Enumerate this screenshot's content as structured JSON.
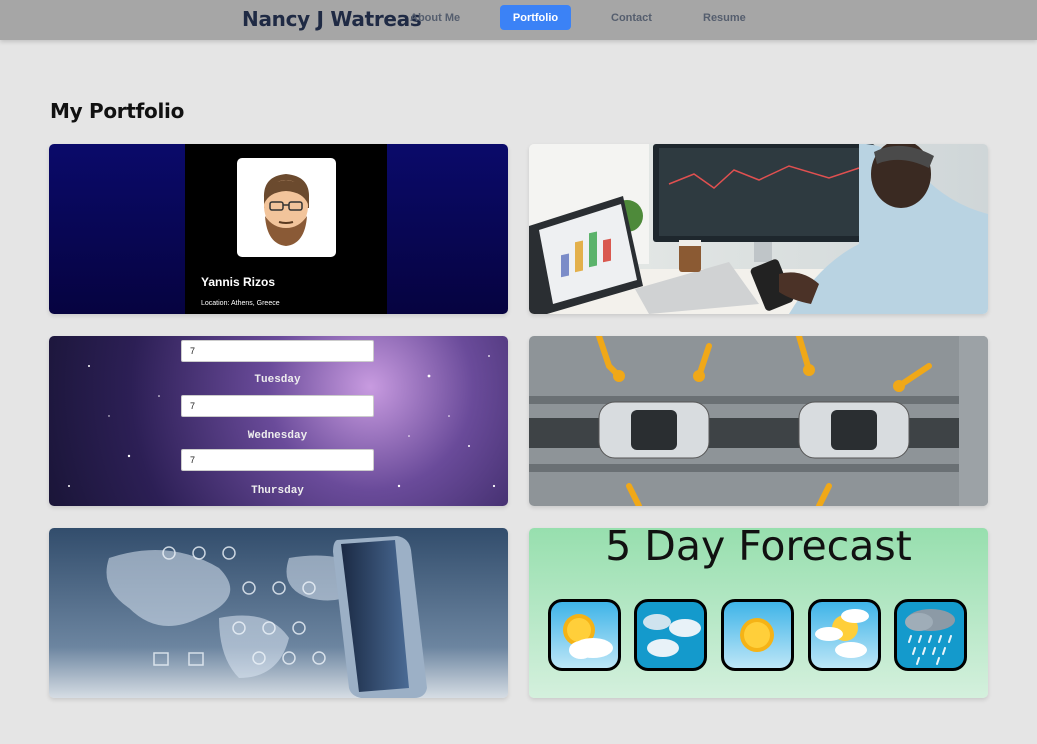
{
  "nav": {
    "brand": "Nancy J Watreas",
    "links": [
      {
        "label": "About Me"
      },
      {
        "label": "Portfolio",
        "active": true
      },
      {
        "label": "Contact"
      },
      {
        "label": "Resume"
      }
    ],
    "active_color": "#3b82f6"
  },
  "main": {
    "title": "My Portfolio"
  },
  "cards": {
    "profile": {
      "name": "Yannis Rizos",
      "location": "Location: Athens, Greece"
    },
    "planner": {
      "rows": [
        {
          "value": "7",
          "day": "Tuesday"
        },
        {
          "value": "7",
          "day": "Wednesday"
        },
        {
          "value": "7",
          "day": "Thursday"
        }
      ]
    },
    "weather": {
      "title": "5 Day Forecast",
      "icons": [
        "sunny-cloud-icon",
        "cloudy-icon",
        "sun-icon",
        "partly-sunny-icon",
        "rain-icon"
      ]
    }
  }
}
